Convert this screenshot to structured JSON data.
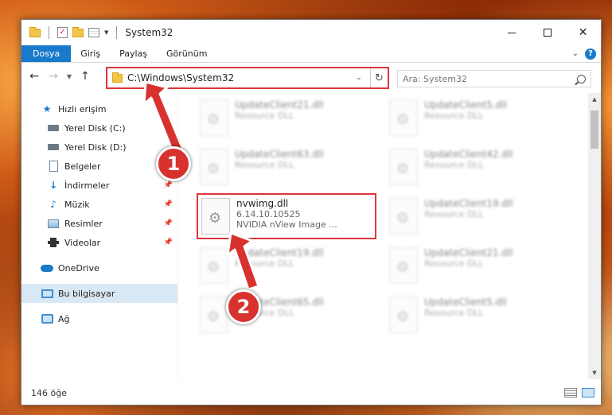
{
  "window": {
    "title": "System32",
    "controls": {
      "close_glyph": "✕"
    }
  },
  "ribbon": {
    "tabs": [
      "Dosya",
      "Giriş",
      "Paylaş",
      "Görünüm"
    ],
    "help": "?"
  },
  "address": {
    "path": "C:\\Windows\\System32",
    "search_placeholder": "Ara: System32"
  },
  "sidebar": {
    "items": [
      {
        "label": "Hızlı erişim"
      },
      {
        "label": "Yerel Disk (C:)"
      },
      {
        "label": "Yerel Disk (D:)"
      },
      {
        "label": "Belgeler"
      },
      {
        "label": "İndirmeler"
      },
      {
        "label": "Müzik"
      },
      {
        "label": "Resimler"
      },
      {
        "label": "Videolar"
      },
      {
        "label": "OneDrive"
      },
      {
        "label": "Bu bilgisayar"
      },
      {
        "label": "Ağ"
      }
    ]
  },
  "files": [
    {
      "name": "UpdateClient21.dll",
      "meta": "Resource DLL"
    },
    {
      "name": "UpdateClient5.dll",
      "meta": "Resource DLL"
    },
    {
      "name": "UpdateClient63.dll",
      "meta": "Resource DLL"
    },
    {
      "name": "UpdateClient42.dll",
      "meta": "Resource DLL"
    },
    {
      "name": "nvwimg.dll",
      "version": "6.14.10.10525",
      "meta": "NVIDIA nView Image ..."
    },
    {
      "name": "UpdateClient19.dll",
      "meta": "Resource DLL"
    },
    {
      "name": "UpdateClient19.dll",
      "meta": "Resource DLL"
    },
    {
      "name": "UpdateClient21.dll",
      "meta": "Resource DLL"
    },
    {
      "name": "UpdateClient65.dll",
      "meta": "Resource DLL"
    },
    {
      "name": "UpdateClient5.dll",
      "meta": "Resource DLL"
    }
  ],
  "status": {
    "count": "146 öğe"
  },
  "callouts": {
    "one": "1",
    "two": "2"
  },
  "colors": {
    "accent": "#1979ca",
    "callout": "#d8322f"
  }
}
